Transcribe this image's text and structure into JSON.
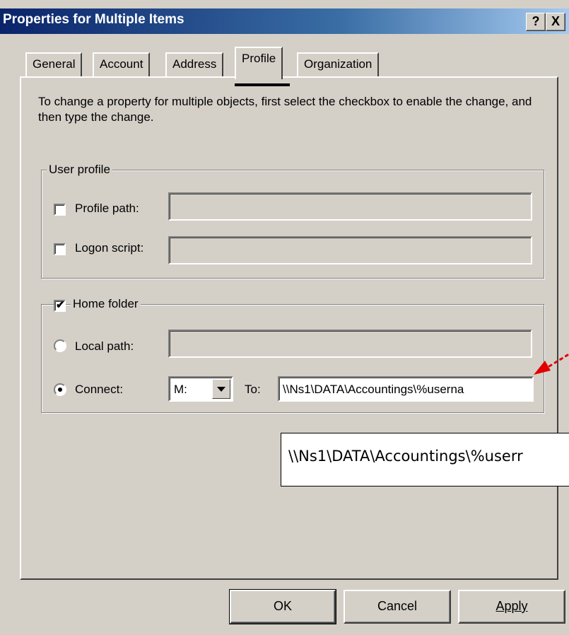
{
  "window": {
    "title": "Properties for Multiple Items",
    "help_glyph": "?",
    "close_glyph": "X"
  },
  "tabs": [
    {
      "label": "General"
    },
    {
      "label": "Account"
    },
    {
      "label": "Address"
    },
    {
      "label": "Profile"
    },
    {
      "label": "Organization"
    }
  ],
  "active_tab": "Profile",
  "intro_text": "To change a property for multiple objects, first select the checkbox to enable the change, and then type the change.",
  "user_profile": {
    "legend": "User profile",
    "profile_path": {
      "label": "Profile path:",
      "checked": false,
      "value": ""
    },
    "logon_script": {
      "label": "Logon script:",
      "checked": false,
      "value": ""
    }
  },
  "home_folder": {
    "legend": "Home folder",
    "checked": true,
    "local_path": {
      "label": "Local path:",
      "selected": false,
      "value": ""
    },
    "connect": {
      "label": "Connect:",
      "selected": true,
      "drive": "M:",
      "to_label": "To:",
      "to_value": "\\\\Ns1\\DATA\\Accountings\\%userna"
    }
  },
  "callout_text": "\\\\Ns1\\DATA\\Accountings\\%userr",
  "buttons": {
    "ok": "OK",
    "cancel": "Cancel",
    "apply": "Apply"
  },
  "colors": {
    "callout_arrow": "#e00000",
    "title_bar": "#0a246a"
  },
  "icons": [
    "help-icon",
    "close-icon",
    "dropdown-arrow-icon",
    "checkbox-check-icon",
    "callout-arrow-icon"
  ]
}
